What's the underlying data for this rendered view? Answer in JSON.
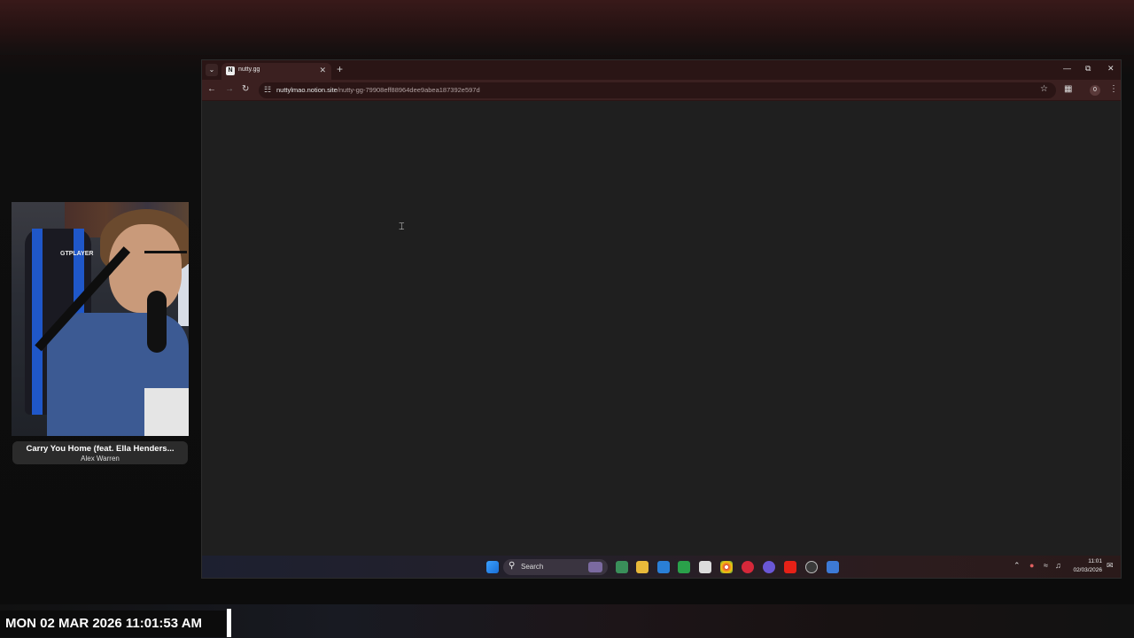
{
  "browser": {
    "tab": {
      "title": "nutty.gg",
      "favicon": "N"
    },
    "address": {
      "host": "nuttylmao.notion.site",
      "path": "/nutty-gg-79908eff88964dee9abea187392e597d"
    },
    "profile_initial": "0"
  },
  "taskbar": {
    "search_label": "Search",
    "time": "11:01",
    "date": "02/03/2026"
  },
  "now_playing": {
    "title": "Carry You Home (feat. Ella Henders...",
    "artist": "Alex Warren"
  },
  "webcam": {
    "chair_logo": "GTPLAYER"
  },
  "overlay_clock": "MON 02 MAR 2026 11:01:53 AM",
  "colors": {
    "accent": "#1f57c9",
    "browser_frame": "#3b2020",
    "page_bg": "#1f1f1f"
  }
}
